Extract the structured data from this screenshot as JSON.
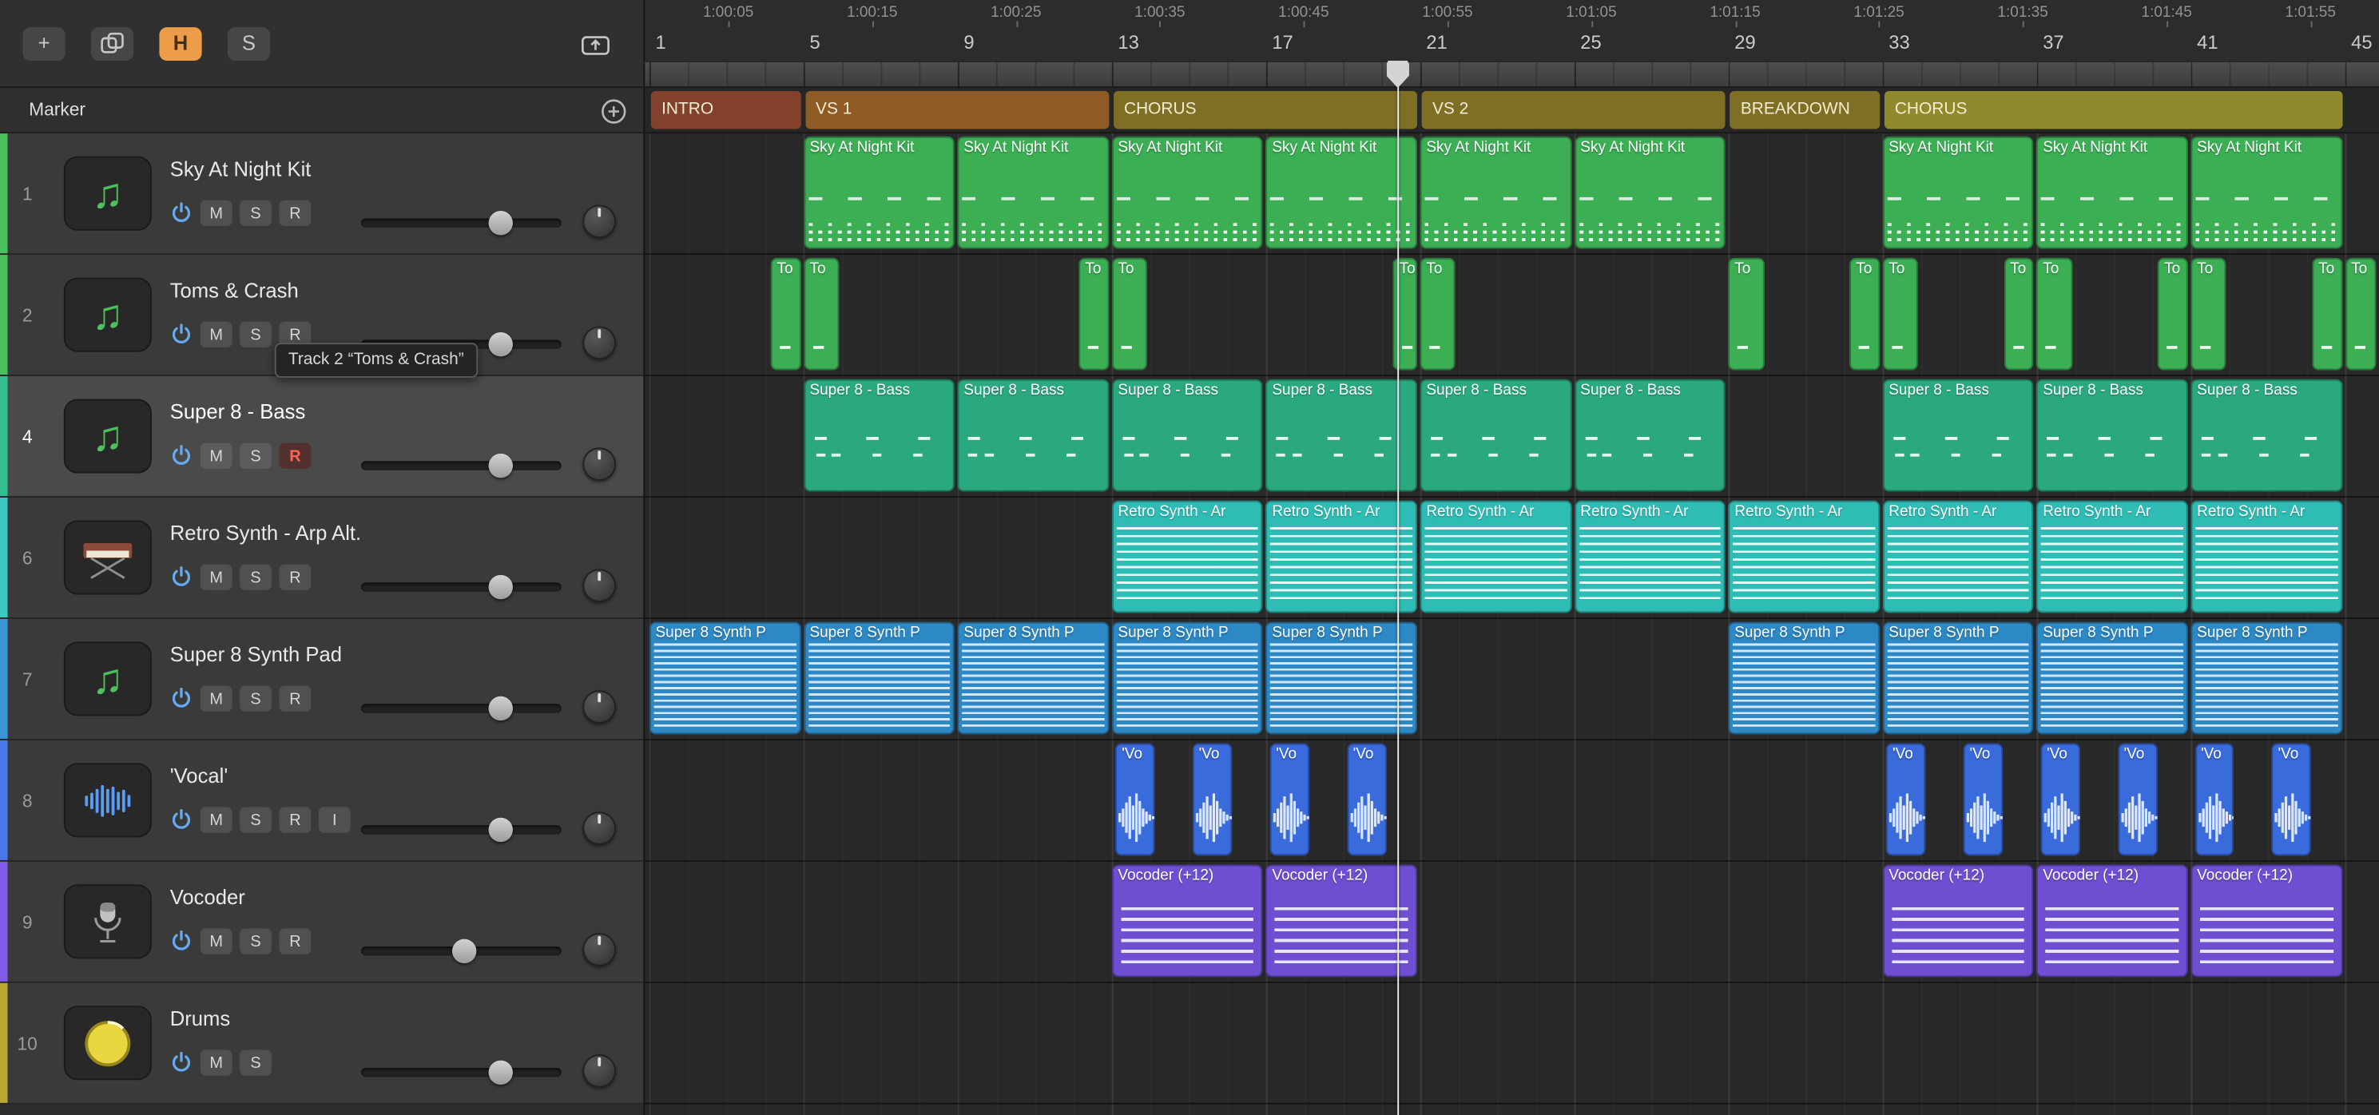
{
  "toolbar": {
    "add_button_label": "+",
    "hide_button_label": "H",
    "solo_button_label": "S"
  },
  "marker_lane": {
    "label": "Marker",
    "sections": [
      {
        "label": "INTRO",
        "start": 1,
        "end": 5,
        "color": "#83412d"
      },
      {
        "label": "VS 1",
        "start": 5,
        "end": 13,
        "color": "#8d5b23"
      },
      {
        "label": "CHORUS",
        "start": 13,
        "end": 21,
        "color": "#7e6f24"
      },
      {
        "label": "VS 2",
        "start": 21,
        "end": 29,
        "color": "#7e6f24"
      },
      {
        "label": "BREAKDOWN",
        "start": 29,
        "end": 33,
        "color": "#7e6f24"
      },
      {
        "label": "CHORUS",
        "start": 33,
        "end": 45,
        "color": "#8f8b2c"
      }
    ]
  },
  "ruler": {
    "bars": [
      1,
      5,
      9,
      13,
      17,
      21,
      25,
      29,
      33,
      37,
      41,
      45
    ],
    "times": [
      "1:00:05",
      "1:00:15",
      "1:00:25",
      "1:00:35",
      "1:00:45",
      "1:00:55",
      "1:01:05",
      "1:01:15",
      "1:01:25",
      "1:01:35",
      "1:01:45",
      "1:01:55"
    ]
  },
  "playhead": {
    "position_bar": 20.4
  },
  "tooltip": {
    "text": "Track 2 “Toms & Crash”"
  },
  "tracks": [
    {
      "num": "1",
      "name": "Sky At Night Kit",
      "icon": "note",
      "strip_color": "#4cc05e",
      "region_color": "#3caf55",
      "pattern": "drums",
      "buttons": [
        "M",
        "S",
        "R"
      ],
      "volume": 0.72,
      "region_label": "Sky At Night Kit",
      "regions": [
        [
          5,
          4
        ],
        [
          9,
          4
        ],
        [
          13,
          4
        ],
        [
          17,
          4
        ],
        [
          21,
          4
        ],
        [
          25,
          4
        ],
        [
          33,
          4
        ],
        [
          37,
          4
        ],
        [
          41,
          4
        ]
      ]
    },
    {
      "num": "2",
      "name": "Toms & Crash",
      "icon": "note",
      "strip_color": "#4cc05e",
      "region_color": "#3caf55",
      "pattern": "toms",
      "buttons": [
        "M",
        "S",
        "R"
      ],
      "volume": 0.72,
      "region_label": "To",
      "regions": [
        [
          4.15,
          0.85
        ],
        [
          5,
          1
        ],
        [
          12.15,
          0.85
        ],
        [
          13,
          1
        ],
        [
          20.3,
          0.7
        ],
        [
          21,
          1
        ],
        [
          29,
          1
        ],
        [
          32.15,
          0.85
        ],
        [
          33,
          1
        ],
        [
          36.15,
          0.85
        ],
        [
          37,
          1
        ],
        [
          40.15,
          0.85
        ],
        [
          41,
          1
        ],
        [
          44.15,
          0.85
        ],
        [
          45,
          0.9
        ]
      ]
    },
    {
      "num": "4",
      "name": "Super 8 - Bass",
      "icon": "note",
      "strip_color": "#35bd92",
      "region_color": "#2aa981",
      "pattern": "bass",
      "buttons": [
        "M",
        "S",
        "R"
      ],
      "record_armed": true,
      "selected": true,
      "volume": 0.72,
      "region_label": "Super 8 - Bass",
      "regions": [
        [
          5,
          4
        ],
        [
          9,
          4
        ],
        [
          13,
          4
        ],
        [
          17,
          4
        ],
        [
          21,
          4
        ],
        [
          25,
          4
        ],
        [
          33,
          4
        ],
        [
          37,
          4
        ],
        [
          41,
          4
        ]
      ]
    },
    {
      "num": "6",
      "name": "Retro Synth - Arp Alt.",
      "icon": "synth",
      "strip_color": "#3fc8c2",
      "region_color": "#2fbcb5",
      "pattern": "arp",
      "buttons": [
        "M",
        "S",
        "R"
      ],
      "volume": 0.72,
      "region_label": "Retro Synth - Ar",
      "regions": [
        [
          13,
          4
        ],
        [
          17,
          4
        ],
        [
          21,
          4
        ],
        [
          25,
          4
        ],
        [
          29,
          4
        ],
        [
          33,
          4
        ],
        [
          37,
          4
        ],
        [
          41,
          4
        ]
      ]
    },
    {
      "num": "7",
      "name": "Super 8 Synth Pad",
      "icon": "note",
      "strip_color": "#3a97d6",
      "region_color": "#2d88c6",
      "pattern": "pad",
      "buttons": [
        "M",
        "S",
        "R"
      ],
      "volume": 0.72,
      "region_label": "Super 8 Synth P",
      "regions": [
        [
          1,
          4
        ],
        [
          5,
          4
        ],
        [
          9,
          4
        ],
        [
          13,
          4
        ],
        [
          17,
          4
        ],
        [
          29,
          4
        ],
        [
          33,
          4
        ],
        [
          37,
          4
        ],
        [
          41,
          4
        ]
      ]
    },
    {
      "num": "8",
      "name": "'Vocal'",
      "icon": "wave",
      "strip_color": "#4a78e8",
      "region_color": "#3a6bdc",
      "pattern": "vocal",
      "buttons": [
        "M",
        "S",
        "R",
        "I"
      ],
      "volume": 0.72,
      "region_label": "'Vo",
      "regions": [
        [
          13.1,
          1.1
        ],
        [
          15.1,
          1.1
        ],
        [
          17.1,
          1.1
        ],
        [
          19.1,
          1.1
        ],
        [
          33.1,
          1.1
        ],
        [
          35.1,
          1.1
        ],
        [
          37.1,
          1.1
        ],
        [
          39.1,
          1.1
        ],
        [
          41.1,
          1.1
        ],
        [
          43.1,
          1.1
        ]
      ]
    },
    {
      "num": "9",
      "name": "Vocoder",
      "icon": "mic",
      "strip_color": "#7e5ce6",
      "region_color": "#6e4fd2",
      "pattern": "vocoder",
      "buttons": [
        "M",
        "S",
        "R"
      ],
      "volume": 0.52,
      "region_label": "Vocoder (+12)",
      "regions": [
        [
          13,
          4
        ],
        [
          17,
          4
        ],
        [
          33,
          4
        ],
        [
          37,
          4
        ],
        [
          41,
          4
        ]
      ]
    },
    {
      "num": "10",
      "name": "Drums",
      "icon": "drum",
      "strip_color": "#b9a930",
      "region_color": "#b9a930",
      "pattern": "",
      "buttons": [
        "M",
        "S"
      ],
      "volume": 0.72,
      "region_label": "",
      "regions": []
    }
  ]
}
